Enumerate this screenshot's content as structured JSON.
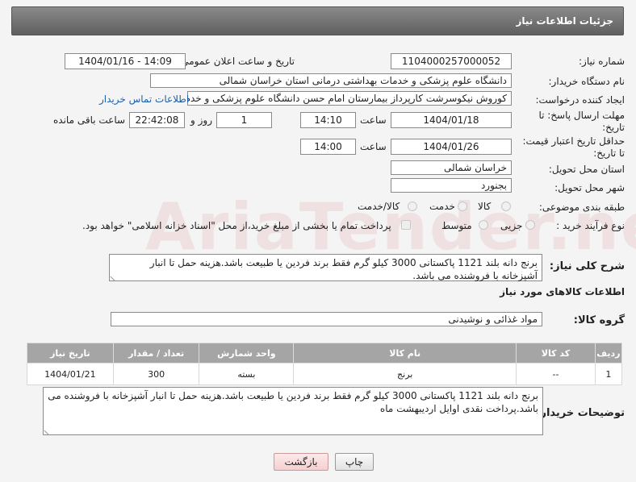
{
  "header": {
    "title": "جزئیات اطلاعات نیاز"
  },
  "fields": {
    "need_number_label": "شماره نیاز:",
    "need_number": "1104000257000052",
    "announce_label": "تاریخ و ساعت اعلان عمومی:",
    "announce_value": "1404/01/16 - 14:09",
    "buyer_org_label": "نام دستگاه خریدار:",
    "buyer_org": "دانشگاه علوم پزشکی و خدمات بهداشتی درمانی استان خراسان شمالی",
    "creator_label": "ایجاد کننده درخواست:",
    "creator": "کوروش نیکوسرشت کارپرداز بیمارستان امام حسن دانشگاه علوم پزشکی و خدم",
    "contact_link": "اطلاعات تماس خریدار",
    "deadline_label_1": "مهلت ارسال پاسخ: تا",
    "deadline_label_2": "تاریخ:",
    "deadline_date": "1404/01/18",
    "time_label": "ساعت",
    "deadline_time": "14:10",
    "days_value": "1",
    "days_label": "روز و",
    "remaining_time": "22:42:08",
    "remaining_label": "ساعت باقی مانده",
    "validity_label_1": "حداقل تاریخ اعتبار قیمت:",
    "validity_label_2": "تا تاریخ:",
    "validity_date": "1404/01/26",
    "validity_time": "14:00",
    "province_label": "استان محل تحویل:",
    "province": "خراسان شمالی",
    "city_label": "شهر محل تحویل:",
    "city": "بجنورد",
    "category_label": "طبقه بندی موضوعی:",
    "category_options": [
      "کالا",
      "خدمت",
      "کالا/خدمت"
    ],
    "process_label": "نوع فرآیند خرید :",
    "process_options": [
      "جزیی",
      "متوسط"
    ],
    "payment_note": "پرداخت تمام یا بخشی از مبلغ خرید،از محل \"اسناد خزانه اسلامی\" خواهد بود.",
    "summary_label": "شرح کلی نیاز:",
    "summary": "برنج دانه بلند 1121 پاکستانی 3000 کیلو گرم فقط برند فردین یا طبیعت باشد.هزینه حمل تا انبار آشپزخانه با فروشنده می باشد.",
    "goods_info_title": "اطلاعات کالاهای مورد نیاز",
    "group_label": "گروه کالا:",
    "group_value": "مواد غذائی و نوشیدنی",
    "buyer_notes_label": "توضیحات خریدار:",
    "buyer_notes": "برنج دانه بلند 1121 پاکستانی 3000 کیلو گرم فقط برند فردین یا طبیعت باشد.هزینه حمل تا انبار آشپزخانه با فروشنده می باشد.پرداخت نقدی اوایل اردیبهشت ماه"
  },
  "table": {
    "headers": [
      "ردیف",
      "کد کالا",
      "نام کالا",
      "واحد شمارش",
      "تعداد / مقدار",
      "تاریخ نیاز"
    ],
    "rows": [
      [
        "1",
        "--",
        "برنج",
        "بسته",
        "300",
        "1404/01/21"
      ]
    ]
  },
  "buttons": {
    "print": "چاپ",
    "back": "بازگشت"
  },
  "watermark": "AriaTender.neT"
}
